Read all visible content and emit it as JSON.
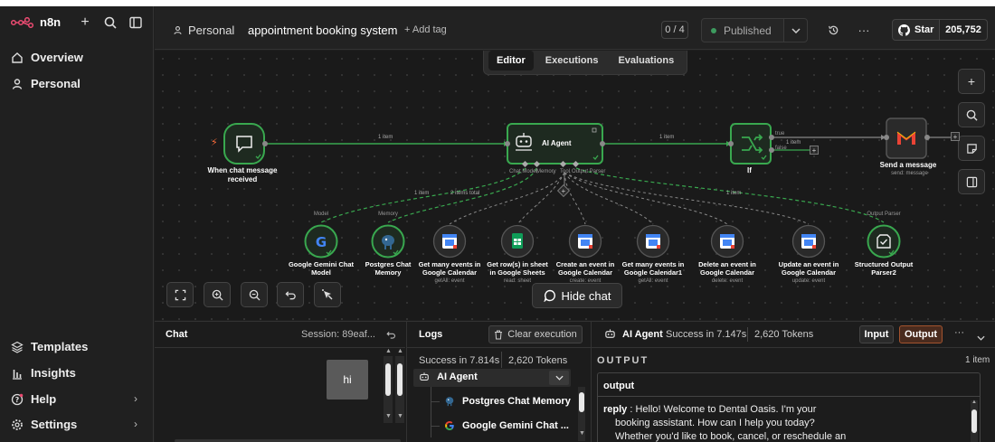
{
  "app": {
    "name": "n8n"
  },
  "sidebar": {
    "items": [
      {
        "label": "Overview",
        "icon": "home-icon"
      },
      {
        "label": "Personal",
        "icon": "user-icon"
      }
    ],
    "bottom_items": [
      {
        "label": "Templates",
        "icon": "templates-icon"
      },
      {
        "label": "Insights",
        "icon": "insights-icon"
      },
      {
        "label": "Help",
        "icon": "help-icon"
      },
      {
        "label": "Settings",
        "icon": "settings-icon"
      }
    ]
  },
  "header": {
    "breadcrumb": "Personal",
    "workflow_title": "appointment booking system",
    "add_tag": "+ Add tag",
    "counter": "0 / 4",
    "published": "Published",
    "star_label": "Star",
    "star_count": "205,752"
  },
  "tabs": [
    "Editor",
    "Executions",
    "Evaluations"
  ],
  "nodes": {
    "trigger": {
      "label1": "When chat message",
      "label2": "received"
    },
    "agent": {
      "label": "AI Agent",
      "port1": "Chat Model",
      "port2": "Memory",
      "port3": "Tool",
      "port4": "Output Parser"
    },
    "if": {
      "label": "If",
      "true": "true",
      "false": "false"
    },
    "gmail": {
      "label": "Send a message",
      "sub": "send: message"
    },
    "tools": [
      {
        "l1": "Google Gemini Chat",
        "l2": "Model",
        "sub": "",
        "top": "Model"
      },
      {
        "l1": "Postgres Chat",
        "l2": "Memory",
        "sub": "",
        "top": "Memory"
      },
      {
        "l1": "Get many events in",
        "l2": "Google Calendar",
        "sub": "getAll: event",
        "top": ""
      },
      {
        "l1": "Get row(s) in sheet",
        "l2": "in Google Sheets",
        "sub": "read: sheet",
        "top": ""
      },
      {
        "l1": "Create an event in",
        "l2": "Google Calendar",
        "sub": "create: event",
        "top": ""
      },
      {
        "l1": "Get many events in",
        "l2": "Google Calendar1",
        "sub": "getAll: event",
        "top": ""
      },
      {
        "l1": "Delete an event in",
        "l2": "Google Calendar",
        "sub": "delete: event",
        "top": ""
      },
      {
        "l1": "Update an event in",
        "l2": "Google Calendar",
        "sub": "update: event",
        "top": ""
      },
      {
        "l1": "Structured Output",
        "l2": "Parser2",
        "sub": "",
        "top": "Output Parser"
      }
    ],
    "wire_labels": {
      "main1": "1 item",
      "main2": "1 item",
      "if_true": "1 item",
      "model": "1 item",
      "memory": "2 items total",
      "parser": "1 item"
    }
  },
  "hide_chat": "Hide chat",
  "chat_panel": {
    "title": "Chat",
    "session": "Session: 89eaf...",
    "message": "hi"
  },
  "logs_panel": {
    "title": "Logs",
    "clear": "Clear execution",
    "success": "Success in 7.814s",
    "tokens": "2,620 Tokens",
    "rows": [
      "AI Agent",
      "Postgres Chat Memory",
      "Google Gemini Chat ..."
    ]
  },
  "output_panel": {
    "node": "AI Agent",
    "success": "Success in 7.147s",
    "tokens": "2,620 Tokens",
    "input_btn": "Input",
    "output_btn": "Output",
    "section": "OUTPUT",
    "count": "1 item",
    "field": "output",
    "reply_key": "reply",
    "reply_line1": ": Hello! Welcome to Dental Oasis. I'm your",
    "reply_line2": "booking assistant. How can I help you today?",
    "reply_line3": "Whether you'd like to book, cancel, or reschedule an"
  },
  "colors": {
    "accent": "#ea4b71",
    "success": "#3d9b5f",
    "wire": "#39a84f"
  }
}
